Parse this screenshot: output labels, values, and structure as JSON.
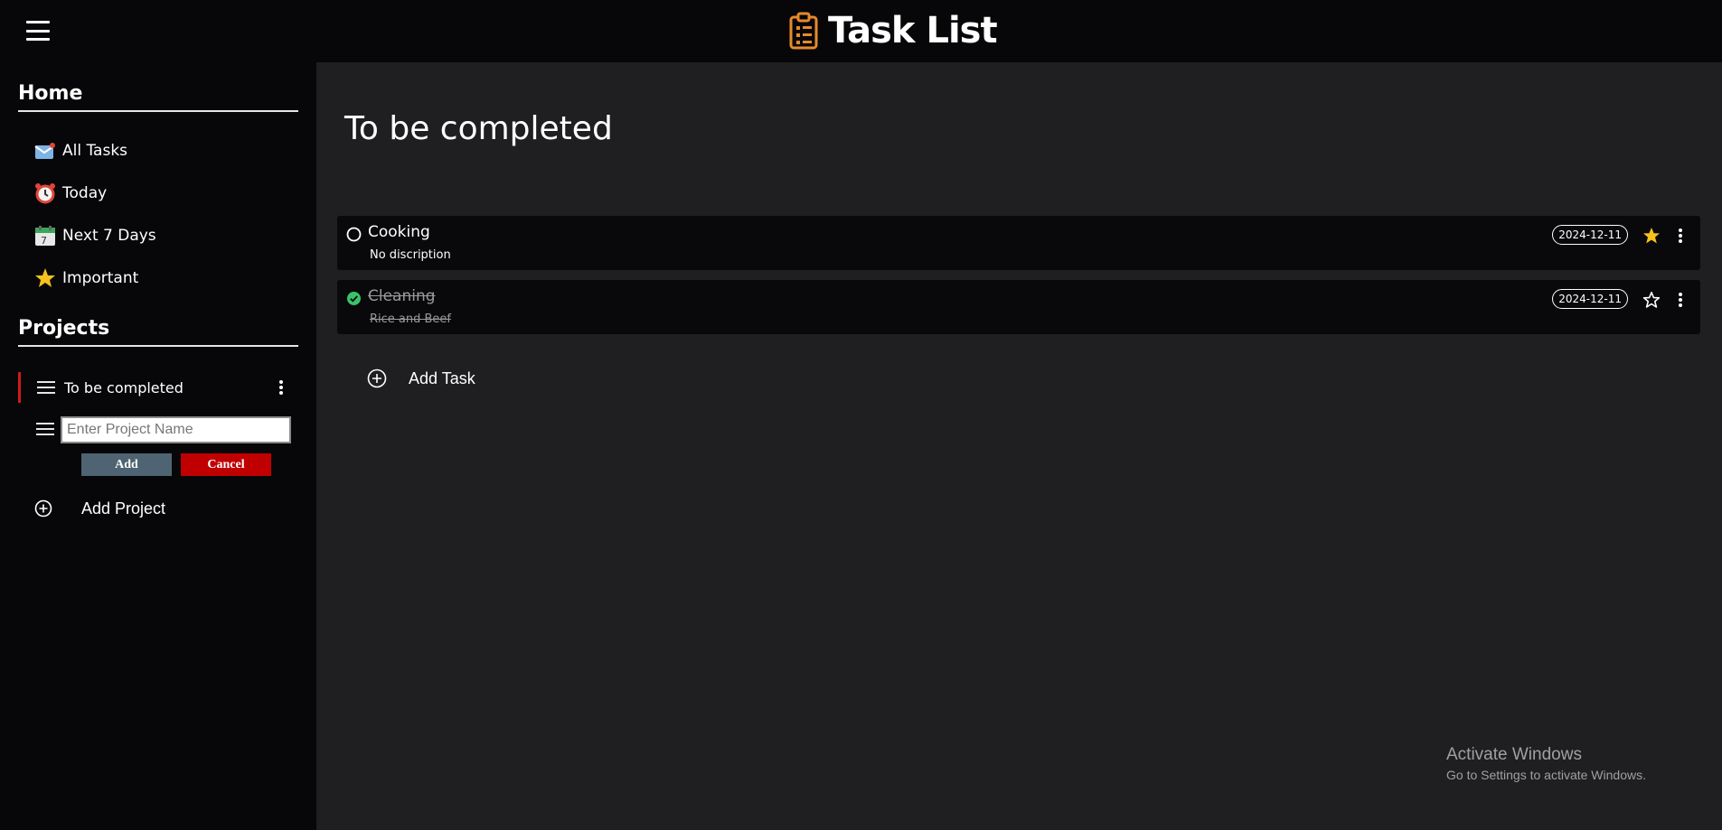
{
  "header": {
    "title": "Task List",
    "menu_icon": "hamburger-menu-icon",
    "logo_icon": "clipboard-list-icon"
  },
  "sidebar": {
    "home_heading": "Home",
    "nav": [
      {
        "label": "All Tasks",
        "icon": "envelope-icon"
      },
      {
        "label": "Today",
        "icon": "alarm-clock-icon"
      },
      {
        "label": "Next 7 Days",
        "icon": "calendar-icon"
      },
      {
        "label": "Important",
        "icon": "star-icon"
      }
    ],
    "projects_heading": "Projects",
    "projects": [
      {
        "label": "To be completed",
        "active": true
      }
    ],
    "new_project": {
      "placeholder": "Enter Project Name",
      "value": "",
      "add_label": "Add",
      "cancel_label": "Cancel"
    },
    "add_project_label": "Add Project"
  },
  "main": {
    "title": "To be completed",
    "tasks": [
      {
        "title": "Cooking",
        "description": "No discription",
        "date": "2024-12-11",
        "completed": false,
        "important": true
      },
      {
        "title": "Cleaning",
        "description": "Rice and Beef",
        "date": "2024-12-11",
        "completed": true,
        "important": false
      }
    ],
    "add_task_label": "Add Task"
  },
  "watermark": {
    "title": "Activate Windows",
    "subtitle": "Go to Settings to activate Windows."
  },
  "colors": {
    "background": "#1f1f22",
    "panel": "#070709",
    "task_bg": "#09090c",
    "accent_red": "#d11a1a",
    "star_gold": "#f6c21c",
    "check_green": "#3ac26a",
    "logo_orange": "#e8892b"
  }
}
